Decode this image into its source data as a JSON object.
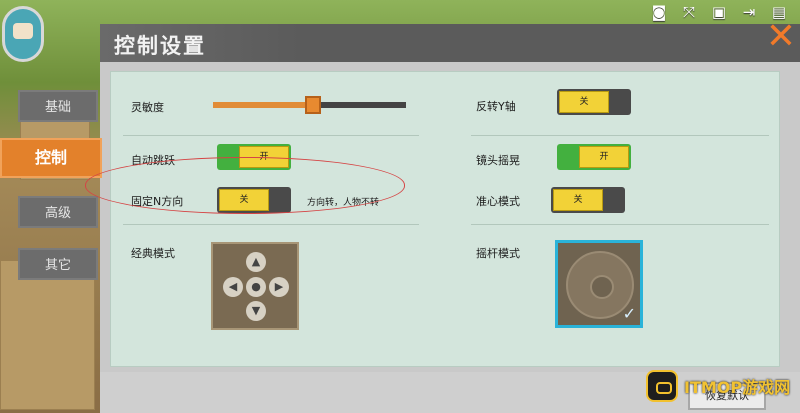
{
  "hud": {
    "icons": [
      "camera-icon",
      "expand-icon",
      "scan-icon",
      "exit-icon",
      "backpack-icon"
    ]
  },
  "dialog": {
    "title": "控制设置",
    "close_glyph": "✕"
  },
  "tabs": [
    {
      "label": "基础",
      "active": false
    },
    {
      "label": "控制",
      "active": true
    },
    {
      "label": "高级",
      "active": false
    },
    {
      "label": "其它",
      "active": false
    }
  ],
  "settings": {
    "sensitivity": {
      "label": "灵敏度",
      "value": 0.52
    },
    "invert_y": {
      "label": "反转Y轴",
      "state": "关"
    },
    "auto_jump": {
      "label": "自动跳跃",
      "state": "开"
    },
    "camera_shake": {
      "label": "镜头摇晃",
      "state": "开"
    },
    "fixed_n": {
      "label": "固定N方向",
      "state": "关",
      "hint": "方向转，人物不转"
    },
    "crosshair": {
      "label": "准心模式",
      "state": "关"
    },
    "classic_mode": {
      "label": "经典模式",
      "selected": false
    },
    "joystick_mode": {
      "label": "摇杆模式",
      "selected": true
    }
  },
  "dpad_glyphs": {
    "up": "▲",
    "down": "▼",
    "left": "◀",
    "right": "▶",
    "center": "●"
  },
  "footer": {
    "restore_label": "恢复默认"
  },
  "watermark": {
    "text": "ITMOP游戏网"
  },
  "colors": {
    "accent": "#e3812b",
    "toggle_on": "#43b03f",
    "toggle_knob": "#f2d237",
    "selected_border": "#2ab3d9",
    "highlight_ellipse": "#d54545"
  }
}
